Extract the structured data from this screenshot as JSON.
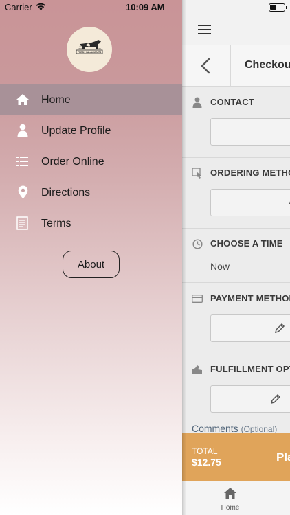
{
  "status_bar": {
    "carrier": "Carrier",
    "time": "10:09 AM"
  },
  "drawer": {
    "logo": {
      "top_text": "SINCE",
      "year_left": "2003",
      "year_right": "2020",
      "brand": "FRESH HALAL MEATS"
    },
    "menu": [
      {
        "label": "Home",
        "icon": "home-icon",
        "active": true
      },
      {
        "label": "Update Profile",
        "icon": "person-icon",
        "active": false
      },
      {
        "label": "Order Online",
        "icon": "list-icon",
        "active": false
      },
      {
        "label": "Directions",
        "icon": "location-pin-icon",
        "active": false
      },
      {
        "label": "Terms",
        "icon": "document-icon",
        "active": false
      }
    ],
    "about_label": "About"
  },
  "app": {
    "page_title": "Checkout",
    "sections": {
      "contact": {
        "title": "CONTACT",
        "icon": "person-icon"
      },
      "ordering_method": {
        "title": "ORDERING METHOD",
        "icon": "hand-pointer-icon"
      },
      "choose_time": {
        "title": "CHOOSE A TIME",
        "icon": "clock-icon",
        "value": "Now"
      },
      "payment_method": {
        "title": "PAYMENT METHOD",
        "icon": "credit-card-icon"
      },
      "fulfillment": {
        "title": "FULFILLMENT OPTIONS",
        "icon": "delivery-icon"
      }
    },
    "comments_label": "Comments",
    "comments_optional": "(Optional)",
    "total": {
      "label": "TOTAL",
      "amount": "$12.75",
      "place_order": "Place Order"
    },
    "tabbar": {
      "home_label": "Home"
    }
  },
  "colors": {
    "active_menu_bg": "#a89198",
    "total_bar": "#e0a45a",
    "drawer_top": "#c99497"
  }
}
